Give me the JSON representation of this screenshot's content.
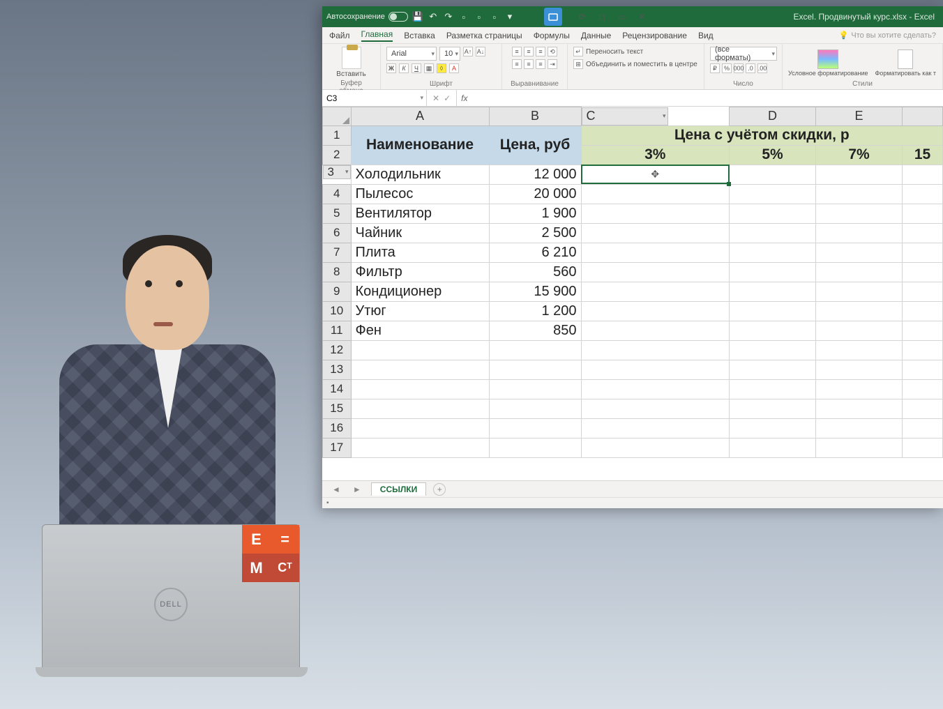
{
  "titlebar": {
    "autosave": "Автосохранение",
    "title": "Excel. Продвинутый курс.xlsx - Excel"
  },
  "menu": {
    "file": "Файл",
    "home": "Главная",
    "insert": "Вставка",
    "layout": "Разметка страницы",
    "formulas": "Формулы",
    "data": "Данные",
    "review": "Рецензирование",
    "view": "Вид",
    "search": "Что вы хотите сделать?"
  },
  "ribbon": {
    "paste": "Вставить",
    "clipboard": "Буфер обмена",
    "font": "Шрифт",
    "font_name": "Arial",
    "font_size": "10",
    "alignment": "Выравнивание",
    "wrap": "Переносить текст",
    "merge": "Объединить и поместить в центре",
    "number": "Число",
    "number_format": "(все форматы)",
    "cond": "Условное форматирование",
    "fmt": "Форматировать как т",
    "styles": "Стили"
  },
  "namebox": "C3",
  "columns": [
    "A",
    "B",
    "C",
    "D",
    "E"
  ],
  "header": {
    "name": "Наименование",
    "price": "Цена, руб",
    "discount_title": "Цена с учётом скидки, р",
    "pcts": [
      "3%",
      "5%",
      "7%",
      "15"
    ]
  },
  "rows": [
    {
      "n": "3",
      "name": "Холодильник",
      "price": "12 000"
    },
    {
      "n": "4",
      "name": "Пылесос",
      "price": "20 000"
    },
    {
      "n": "5",
      "name": "Вентилятор",
      "price": "1 900"
    },
    {
      "n": "6",
      "name": "Чайник",
      "price": "2 500"
    },
    {
      "n": "7",
      "name": "Плита",
      "price": "6 210"
    },
    {
      "n": "8",
      "name": "Фильтр",
      "price": "560"
    },
    {
      "n": "9",
      "name": "Кондиционер",
      "price": "15 900"
    },
    {
      "n": "10",
      "name": "Утюг",
      "price": "1 200"
    },
    {
      "n": "11",
      "name": "Фен",
      "price": "850"
    }
  ],
  "empty_rows": [
    "12",
    "13",
    "14",
    "15",
    "16",
    "17"
  ],
  "tabs": {
    "sheet": "ССЫЛКИ"
  },
  "laptop": {
    "brand": "DELL",
    "e": "E",
    "eq": "=",
    "m": "M",
    "c": "Cᵀ"
  }
}
